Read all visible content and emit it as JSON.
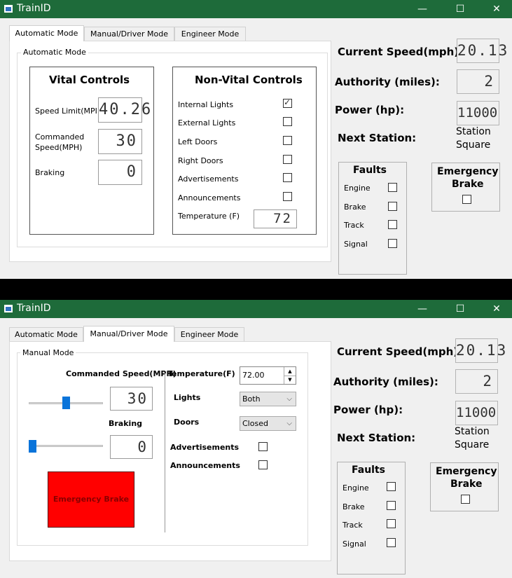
{
  "window_title": "TrainID",
  "window_controls": {
    "minimize": "—",
    "maximize": "☐",
    "close": "✕"
  },
  "tabs": [
    "Automatic Mode",
    "Manual/Driver Mode",
    "Engineer Mode"
  ],
  "auto": {
    "group_label": "Automatic Mode",
    "vital": {
      "title": "Vital Controls",
      "speed_limit_label": "Speed Limit(MPI",
      "speed_limit_value": "40.26",
      "commanded_label_1": "Commanded",
      "commanded_label_2": "Speed(MPH)",
      "commanded_value": "30",
      "braking_label": "Braking",
      "braking_value": "0"
    },
    "nonvital": {
      "title": "Non-Vital Controls",
      "items": [
        {
          "label": "Internal Lights",
          "checked": true
        },
        {
          "label": "External Lights",
          "checked": false
        },
        {
          "label": "Left Doors",
          "checked": false
        },
        {
          "label": "Right Doors",
          "checked": false
        },
        {
          "label": "Advertisements",
          "checked": false
        },
        {
          "label": "Announcements",
          "checked": false
        }
      ],
      "temperature_label": "Temperature (F)",
      "temperature_value": "72"
    }
  },
  "manual": {
    "group_label": "Manual Mode",
    "commanded_label": "Commanded Speed(MPH)",
    "commanded_value": "30",
    "commanded_slider_level": 0.5,
    "braking_label": "Braking",
    "braking_value": "0",
    "braking_slider_level": 0.0,
    "emergency_button": "Emergency Brake",
    "temperature_label": "Temperature(F)",
    "temperature_value": "72.00",
    "lights_label": "Lights",
    "lights_value": "Both",
    "doors_label": "Doors",
    "doors_value": "Closed",
    "advertisements_label": "Advertisements",
    "announcements_label": "Announcements"
  },
  "status": {
    "current_speed_label": "Current Speed(mph):",
    "current_speed_value": "20.13",
    "authority_label": "Authority (miles):",
    "authority_value": "2",
    "power_label": "Power (hp):",
    "power_value": "11000",
    "next_station_label": "Next Station:",
    "next_station_value_1": "Station",
    "next_station_value_2": "Square",
    "faults_title": "Faults",
    "faults": [
      "Engine",
      "Brake",
      "Track",
      "Signal"
    ],
    "emergency_title_1": "Emergency",
    "emergency_title_2": "Brake"
  },
  "colors": {
    "titlebar": "#1e6b3a",
    "emergency_button": "#ff0000",
    "slider": "#0a74da"
  }
}
